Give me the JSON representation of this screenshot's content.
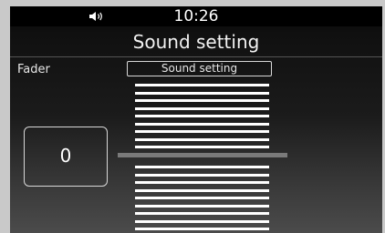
{
  "status_bar": {
    "time": "10:26",
    "volume_icon": "speaker-volume-icon"
  },
  "header": {
    "title": "Sound setting"
  },
  "fader": {
    "label": "Fader",
    "button_label": "Sound setting",
    "value": "0",
    "lines_above_center": 9,
    "lines_below_center": 9
  }
}
